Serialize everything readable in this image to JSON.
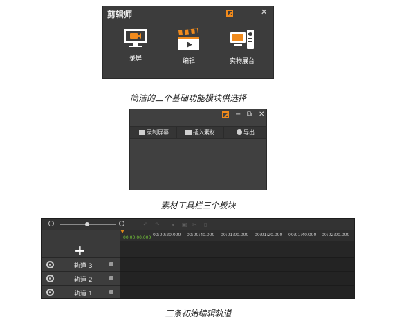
{
  "panel1": {
    "title": "剪辑师",
    "controls": {
      "minimize": "−",
      "close": "✕"
    },
    "functions": [
      {
        "label": "录屏",
        "icon": "monitor-record-icon"
      },
      {
        "label": "编辑",
        "icon": "clapperboard-icon"
      },
      {
        "label": "实物展台",
        "icon": "document-camera-icon"
      }
    ],
    "accent": "#f08a1c"
  },
  "caption1": "简洁的三个基础功能模块供选择",
  "panel2": {
    "controls": {
      "minimize": "−",
      "restore": "⧉",
      "close": "✕"
    },
    "toolbar": [
      {
        "label": "录制屏幕",
        "icon": "record-screen-icon"
      },
      {
        "label": "插入素材",
        "icon": "insert-media-icon"
      },
      {
        "label": "导出",
        "icon": "export-icon"
      }
    ]
  },
  "caption2": "素材工具栏三个板块",
  "panel3": {
    "add_label": "+",
    "ruler_labels": [
      "00:00:00.000",
      "00:00:20.000",
      "00:00:40.000",
      "00:01:00.000",
      "00:01:20.000",
      "00:01:40.000",
      "00:02:00.000"
    ],
    "tracks": [
      {
        "label": "轨道 3"
      },
      {
        "label": "轨道 2"
      },
      {
        "label": "轨道 1"
      }
    ],
    "playhead_color": "#e08a1a",
    "time_color": "#74c43a"
  },
  "caption3": "三条初始编辑轨道"
}
